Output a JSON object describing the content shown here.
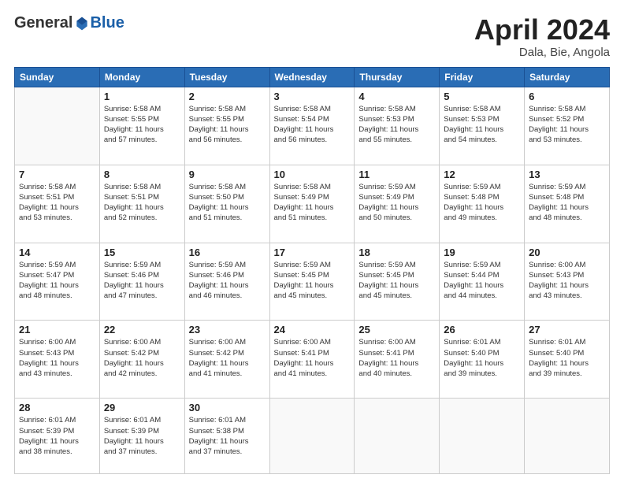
{
  "header": {
    "logo_general": "General",
    "logo_blue": "Blue",
    "month_title": "April 2024",
    "location": "Dala, Bie, Angola"
  },
  "days_of_week": [
    "Sunday",
    "Monday",
    "Tuesday",
    "Wednesday",
    "Thursday",
    "Friday",
    "Saturday"
  ],
  "weeks": [
    [
      {
        "day": "",
        "info": ""
      },
      {
        "day": "1",
        "info": "Sunrise: 5:58 AM\nSunset: 5:55 PM\nDaylight: 11 hours\nand 57 minutes."
      },
      {
        "day": "2",
        "info": "Sunrise: 5:58 AM\nSunset: 5:55 PM\nDaylight: 11 hours\nand 56 minutes."
      },
      {
        "day": "3",
        "info": "Sunrise: 5:58 AM\nSunset: 5:54 PM\nDaylight: 11 hours\nand 56 minutes."
      },
      {
        "day": "4",
        "info": "Sunrise: 5:58 AM\nSunset: 5:53 PM\nDaylight: 11 hours\nand 55 minutes."
      },
      {
        "day": "5",
        "info": "Sunrise: 5:58 AM\nSunset: 5:53 PM\nDaylight: 11 hours\nand 54 minutes."
      },
      {
        "day": "6",
        "info": "Sunrise: 5:58 AM\nSunset: 5:52 PM\nDaylight: 11 hours\nand 53 minutes."
      }
    ],
    [
      {
        "day": "7",
        "info": ""
      },
      {
        "day": "8",
        "info": "Sunrise: 5:58 AM\nSunset: 5:51 PM\nDaylight: 11 hours\nand 52 minutes."
      },
      {
        "day": "9",
        "info": "Sunrise: 5:58 AM\nSunset: 5:50 PM\nDaylight: 11 hours\nand 51 minutes."
      },
      {
        "day": "10",
        "info": "Sunrise: 5:58 AM\nSunset: 5:49 PM\nDaylight: 11 hours\nand 51 minutes."
      },
      {
        "day": "11",
        "info": "Sunrise: 5:59 AM\nSunset: 5:49 PM\nDaylight: 11 hours\nand 50 minutes."
      },
      {
        "day": "12",
        "info": "Sunrise: 5:59 AM\nSunset: 5:48 PM\nDaylight: 11 hours\nand 49 minutes."
      },
      {
        "day": "13",
        "info": "Sunrise: 5:59 AM\nSunset: 5:48 PM\nDaylight: 11 hours\nand 48 minutes."
      }
    ],
    [
      {
        "day": "14",
        "info": ""
      },
      {
        "day": "15",
        "info": "Sunrise: 5:59 AM\nSunset: 5:46 PM\nDaylight: 11 hours\nand 47 minutes."
      },
      {
        "day": "16",
        "info": "Sunrise: 5:59 AM\nSunset: 5:46 PM\nDaylight: 11 hours\nand 46 minutes."
      },
      {
        "day": "17",
        "info": "Sunrise: 5:59 AM\nSunset: 5:45 PM\nDaylight: 11 hours\nand 45 minutes."
      },
      {
        "day": "18",
        "info": "Sunrise: 5:59 AM\nSunset: 5:45 PM\nDaylight: 11 hours\nand 45 minutes."
      },
      {
        "day": "19",
        "info": "Sunrise: 5:59 AM\nSunset: 5:44 PM\nDaylight: 11 hours\nand 44 minutes."
      },
      {
        "day": "20",
        "info": "Sunrise: 6:00 AM\nSunset: 5:43 PM\nDaylight: 11 hours\nand 43 minutes."
      }
    ],
    [
      {
        "day": "21",
        "info": ""
      },
      {
        "day": "22",
        "info": "Sunrise: 6:00 AM\nSunset: 5:42 PM\nDaylight: 11 hours\nand 42 minutes."
      },
      {
        "day": "23",
        "info": "Sunrise: 6:00 AM\nSunset: 5:42 PM\nDaylight: 11 hours\nand 41 minutes."
      },
      {
        "day": "24",
        "info": "Sunrise: 6:00 AM\nSunset: 5:41 PM\nDaylight: 11 hours\nand 41 minutes."
      },
      {
        "day": "25",
        "info": "Sunrise: 6:00 AM\nSunset: 5:41 PM\nDaylight: 11 hours\nand 40 minutes."
      },
      {
        "day": "26",
        "info": "Sunrise: 6:01 AM\nSunset: 5:40 PM\nDaylight: 11 hours\nand 39 minutes."
      },
      {
        "day": "27",
        "info": "Sunrise: 6:01 AM\nSunset: 5:40 PM\nDaylight: 11 hours\nand 39 minutes."
      }
    ],
    [
      {
        "day": "28",
        "info": "Sunrise: 6:01 AM\nSunset: 5:39 PM\nDaylight: 11 hours\nand 38 minutes."
      },
      {
        "day": "29",
        "info": "Sunrise: 6:01 AM\nSunset: 5:39 PM\nDaylight: 11 hours\nand 37 minutes."
      },
      {
        "day": "30",
        "info": "Sunrise: 6:01 AM\nSunset: 5:38 PM\nDaylight: 11 hours\nand 37 minutes."
      },
      {
        "day": "",
        "info": ""
      },
      {
        "day": "",
        "info": ""
      },
      {
        "day": "",
        "info": ""
      },
      {
        "day": "",
        "info": ""
      }
    ]
  ],
  "week7_sunday": {
    "info": "Sunrise: 5:58 AM\nSunset: 5:51 PM\nDaylight: 11 hours\nand 53 minutes."
  },
  "week3_sunday": {
    "info": "Sunrise: 5:59 AM\nSunset: 5:47 PM\nDaylight: 11 hours\nand 48 minutes."
  },
  "week4_sunday": {
    "info": "Sunrise: 6:00 AM\nSunset: 5:43 PM\nDaylight: 11 hours\nand 43 minutes."
  },
  "week5_sunday": {
    "info": "Sunrise: 6:00 AM\nSunset: 5:43 PM\nDaylight: 11 hours\nand 43 minutes."
  }
}
